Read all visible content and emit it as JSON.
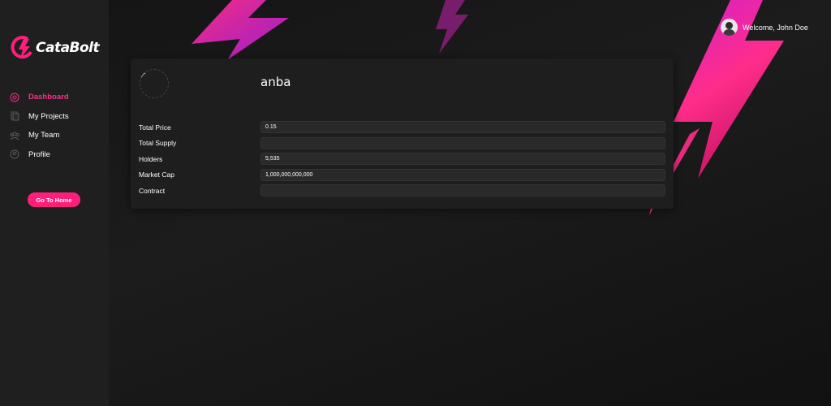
{
  "brand": {
    "name": "CataBolt",
    "accent": "#ff1f7a",
    "bg": "#1a1a1a"
  },
  "sidebar": {
    "items": [
      {
        "label": "Dashboard",
        "icon": "dashboard-icon",
        "active": true
      },
      {
        "label": "My Projects",
        "icon": "projects-icon",
        "active": false
      },
      {
        "label": "My Team",
        "icon": "team-icon",
        "active": false
      },
      {
        "label": "Profile",
        "icon": "profile-icon",
        "active": false
      }
    ],
    "home_button": "Go To Home"
  },
  "header": {
    "welcome": "Welcome, John Doe",
    "avatar_icon": "user-avatar-icon"
  },
  "token": {
    "name": "anba",
    "fields": [
      {
        "label": "Total Price",
        "value": "0.15"
      },
      {
        "label": "Total Supply",
        "value": ""
      },
      {
        "label": "Holders",
        "value": "5,535"
      },
      {
        "label": "Market Cap",
        "value": "1,000,000,000,000"
      },
      {
        "label": "Contract",
        "value": ""
      }
    ]
  }
}
